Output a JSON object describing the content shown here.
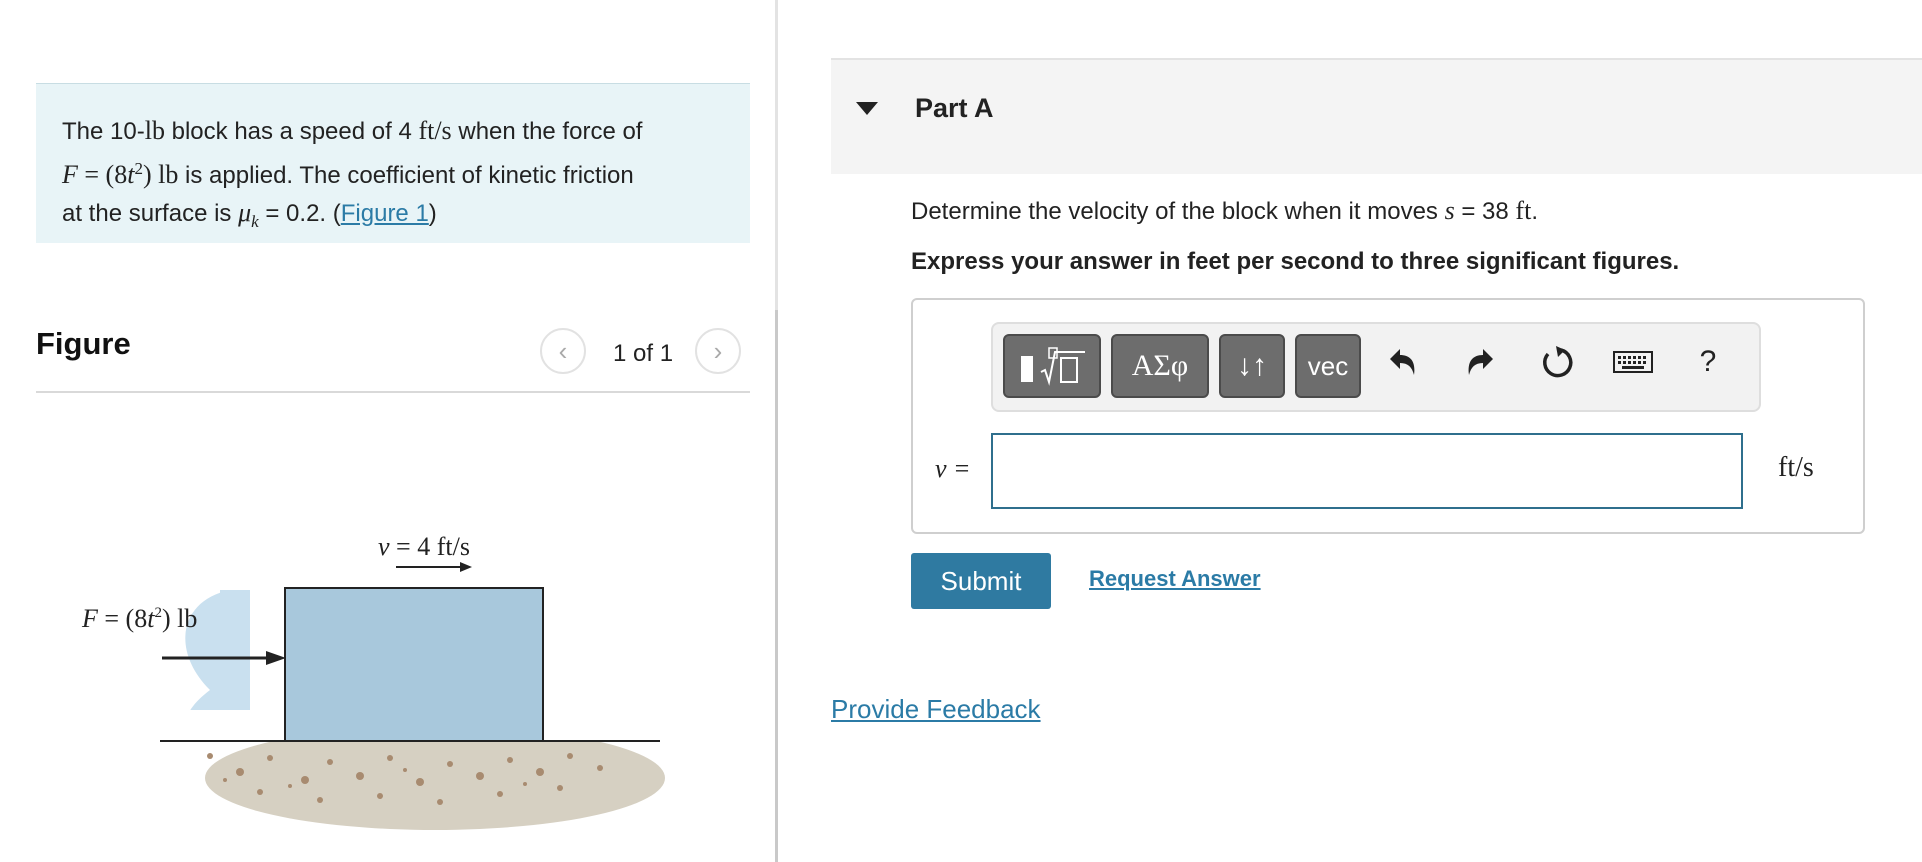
{
  "problem": {
    "t1": "The 10-",
    "unit_lb": "lb",
    "t2": " block has a speed of 4 ",
    "unit_speed": "ft/s",
    "t3": " when the force of",
    "force_var": "F",
    "force_eq": " = (8",
    "force_t": "t",
    "force_exp": "2",
    "force_close": ") ",
    "force_unit": "lb",
    "t4": " is applied. The coefficient of kinetic friction",
    "t5": "at the surface is ",
    "mu": "μ",
    "mu_sub": "k",
    "t6": " = 0.2. (",
    "figure_link": "Figure 1",
    "t7": ")"
  },
  "figure": {
    "title": "Figure",
    "counter": "1 of 1",
    "prev_symbol": "‹",
    "next_symbol": "›",
    "velocity_label": "v = 4 ft/s",
    "force_label": "F = (8t²) lb",
    "colors": {
      "block": "#a8c8dc",
      "shadow": "#c9e0ef",
      "ground": "#cfc8b6"
    }
  },
  "part": {
    "title": "Part A",
    "question_pre": "Determine the velocity of the block when it moves ",
    "question_var": "s",
    "question_eq": " = 38 ",
    "question_unit": "ft",
    "question_end": ".",
    "instruction": "Express your answer in feet per second to three significant figures."
  },
  "toolbar": {
    "greek_label": "ΑΣφ",
    "arrows_label": "↓↑",
    "vec_label": "vec",
    "help_label": "?",
    "icons": [
      "templates-icon",
      "undo-icon",
      "redo-icon",
      "reset-icon",
      "keyboard-icon"
    ]
  },
  "answer": {
    "label": "v =",
    "value": "",
    "units": "ft/s"
  },
  "actions": {
    "submit": "Submit",
    "request_answer": "Request Answer",
    "feedback": "Provide Feedback"
  },
  "colors": {
    "accent": "#2f7aa1",
    "link": "#2b7ba6",
    "problem_bg": "#e8f4f7",
    "toolbar_button": "#6d6d6d"
  }
}
